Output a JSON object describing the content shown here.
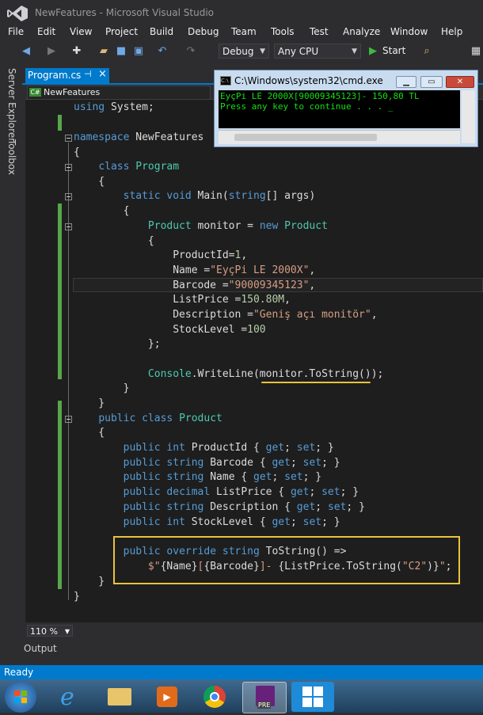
{
  "window": {
    "title": "NewFeatures - Microsoft Visual Studio"
  },
  "menu": [
    "File",
    "Edit",
    "View",
    "Project",
    "Build",
    "Debug",
    "Team",
    "Tools",
    "Test",
    "Analyze",
    "Window",
    "Help"
  ],
  "toolbar": {
    "configuration": "Debug",
    "platform": "Any CPU",
    "start_label": "Start"
  },
  "sidebar": {
    "server_explorer": "Server Explorer",
    "toolbox": "Toolbox"
  },
  "tabs": {
    "active_file": "Program.cs",
    "pin": "⊣",
    "close": "×",
    "nav_project": "NewFeatures",
    "nav_badge": "C#"
  },
  "code_lines": [
    "using System;",
    "",
    "namespace NewFeatures",
    "{",
    "    class Program",
    "    {",
    "        static void Main(string[] args)",
    "        {",
    "            Product monitor = new Product",
    "            {",
    "                ProductId=1,",
    "                Name =\"EyçPi LE 2000X\",",
    "                Barcode =\"90009345123\",",
    "                ListPrice =150.80M,",
    "                Description =\"Geniş açı monitör\",",
    "                StockLevel =100",
    "            };",
    "",
    "            Console.WriteLine(monitor.ToString());",
    "        }",
    "    }",
    "    public class Product",
    "    {",
    "        public int ProductId { get; set; }",
    "        public string Barcode { get; set; }",
    "        public string Name { get; set; }",
    "        public decimal ListPrice { get; set; }",
    "        public string Description { get; set; }",
    "        public int StockLevel { get; set; }",
    "",
    "        public override string ToString() =>",
    "            $\"{Name}[{Barcode}]- {ListPrice.ToString(\"C2\")}\";",
    "    }",
    "}"
  ],
  "editor": {
    "zoom": "110 %",
    "output_label": "Output"
  },
  "status": {
    "text": "Ready"
  },
  "cmd": {
    "title": "C:\\Windows\\system32\\cmd.exe",
    "line1": "EyçPi LE 2000X[90009345123]- 150,80 TL",
    "line2": "Press any key to continue . . . _"
  },
  "colors": {
    "accent": "#007acc",
    "editor_bg": "#1e1e1e",
    "highlight_box": "#e8c33d",
    "console_text": "#14e014"
  }
}
